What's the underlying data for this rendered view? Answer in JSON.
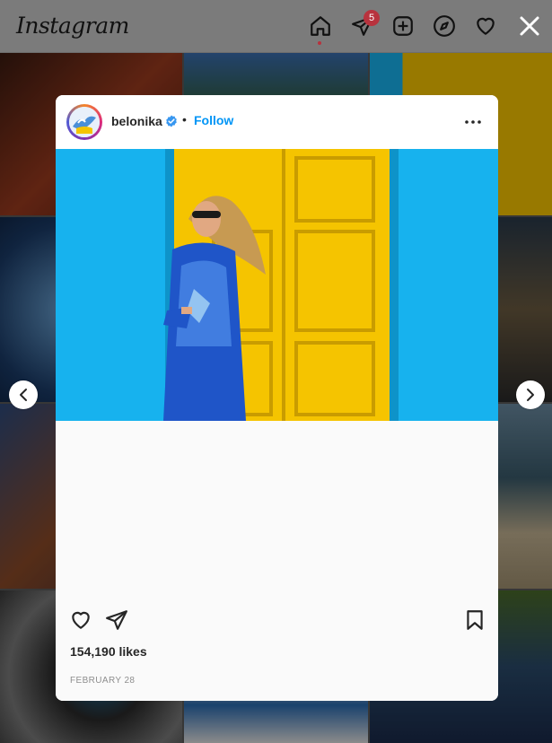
{
  "header": {
    "logo": "Instagram",
    "notification_count": "5",
    "icons": [
      "home-icon",
      "direct-message-icon",
      "new-post-icon",
      "explore-icon",
      "activity-heart-icon"
    ]
  },
  "post": {
    "username": "belonika",
    "verified": true,
    "separator": "•",
    "follow_label": "Follow",
    "likes": "154,190 likes",
    "date": "FEBRUARY 28"
  },
  "colors": {
    "follow": "#0095f6",
    "badge": "#b8323d",
    "verified": "#3897f0",
    "photo_wall": "#17b2ee",
    "photo_door": "#f5c400",
    "dress": "#1f55c8"
  }
}
